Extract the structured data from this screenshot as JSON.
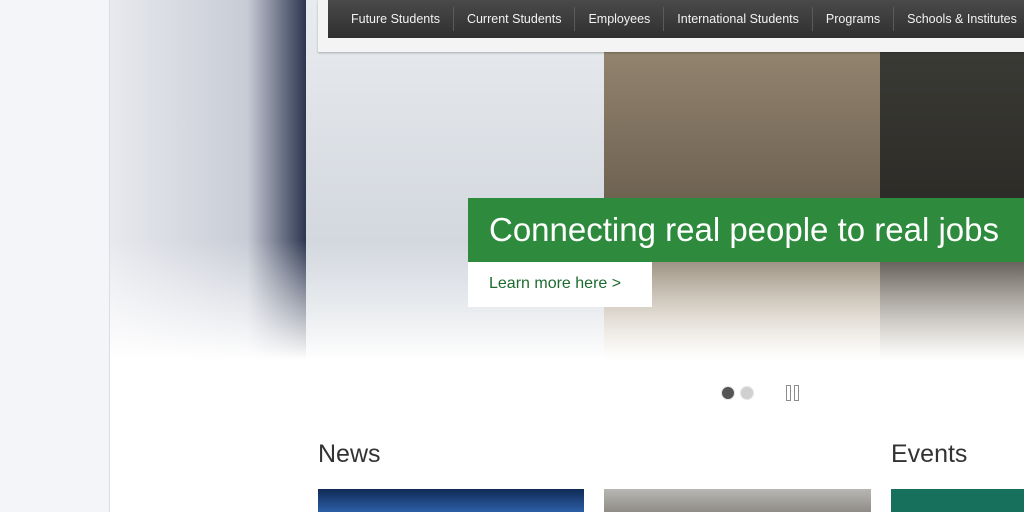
{
  "nav": {
    "items": [
      "Future Students",
      "Current Students",
      "Employees",
      "International Students",
      "Programs",
      "Schools & Institutes"
    ]
  },
  "hero": {
    "headline": "Connecting real people to real jobs",
    "cta": "Learn more here >",
    "slides_total": 2,
    "active_slide": 1
  },
  "sections": {
    "news_title": "News",
    "events_title": "Events"
  },
  "colors": {
    "brand_green": "#2e8b3e",
    "nav_background": "#3a3a3a"
  }
}
